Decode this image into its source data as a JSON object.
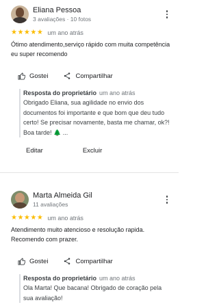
{
  "reviews": [
    {
      "name": "Eliana Pessoa",
      "meta": "3 avaliações · 10 fotos",
      "stars": "★★★★★",
      "date": "um ano atrás",
      "text": "Ótimo atendimento,serviço rápido com muita competência eu super recomendo",
      "like_label": "Gostei",
      "share_label": "Compartilhar",
      "reply": {
        "title": "Resposta do proprietário",
        "date": "um ano atrás",
        "text": "Obrigado Eliana, sua agilidade no envio dos documentos foi importante e que bom que deu tudo certo! Se precisar novamente, basta me chamar, ok?! Boa tarde! 🌲 ..."
      },
      "edit_label": "Editar",
      "delete_label": "Excluir"
    },
    {
      "name": "Marta Almeida Gil",
      "meta": "11 avaliações",
      "stars": "★★★★★",
      "date": "um ano atrás",
      "text": "Atendimento muito atencioso e resolução rapida. Recomendo com prazer.",
      "like_label": "Gostei",
      "share_label": "Compartilhar",
      "reply": {
        "title": "Resposta do proprietário",
        "date": "um ano atrás",
        "text": "Ola Marta! Que bacana! Obrigado de coração pela sua avaliação!"
      }
    }
  ],
  "colors": {
    "star": "#fbbc04",
    "secondary_text": "#70757a",
    "divider": "#e3e3e3"
  }
}
